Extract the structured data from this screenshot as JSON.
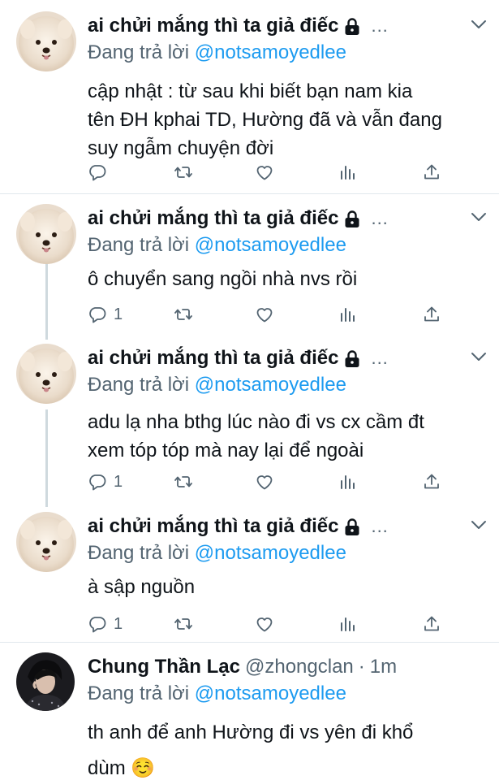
{
  "tweets": [
    {
      "name": "ai chửi mắng thì ta giả điếc",
      "protected": true,
      "menu": "...",
      "reply_prefix": "Đang trả lời",
      "reply_to": "@notsamoyedlee",
      "text_lines": [
        "cập nhật : từ sau khi biết bạn nam kia",
        "tên ĐH kphai TD, Hường đã và vẫn đang",
        "suy ngẫm chuyện đời"
      ],
      "reply_count": "",
      "avatar": "samoyed-avatar"
    },
    {
      "name": "ai chửi mắng thì ta giả điếc",
      "protected": true,
      "menu": "...",
      "reply_prefix": "Đang trả lời",
      "reply_to": "@notsamoyedlee",
      "text_lines": [
        "ô chuyển sang ngồi nhà nvs rồi"
      ],
      "reply_count": "1",
      "avatar": "samoyed-avatar"
    },
    {
      "name": "ai chửi mắng thì ta giả điếc",
      "protected": true,
      "menu": "...",
      "reply_prefix": "Đang trả lời",
      "reply_to": "@notsamoyedlee",
      "text_lines": [
        "adu lạ nha bthg lúc nào đi vs cx cầm đt",
        "xem tóp tóp mà nay lại để ngoài"
      ],
      "reply_count": "1",
      "avatar": "samoyed-avatar"
    },
    {
      "name": "ai chửi mắng thì ta giả điếc",
      "protected": true,
      "menu": "...",
      "reply_prefix": "Đang trả lời",
      "reply_to": "@notsamoyedlee",
      "text_lines": [
        "à sập nguồn"
      ],
      "reply_count": "1",
      "avatar": "samoyed-avatar"
    },
    {
      "name": "Chung Thần Lạc",
      "handle": "@zhongclan",
      "separator": "·",
      "time": "1m",
      "protected": false,
      "reply_prefix": "Đang trả lời",
      "reply_to": "@notsamoyedlee",
      "text_lines": [
        "th anh để anh Hường đi vs yên đi khổ",
        "dùm ☺️"
      ],
      "avatar": "person-avatar"
    }
  ],
  "colors": {
    "link": "#1d9bf0",
    "secondary": "#536471",
    "thread_line": "#cfd9de",
    "divider": "#e1e8ed"
  },
  "icons": [
    "reply-icon",
    "retweet-icon",
    "like-icon",
    "analytics-icon",
    "share-icon",
    "lock-icon",
    "chevron-down-icon"
  ]
}
